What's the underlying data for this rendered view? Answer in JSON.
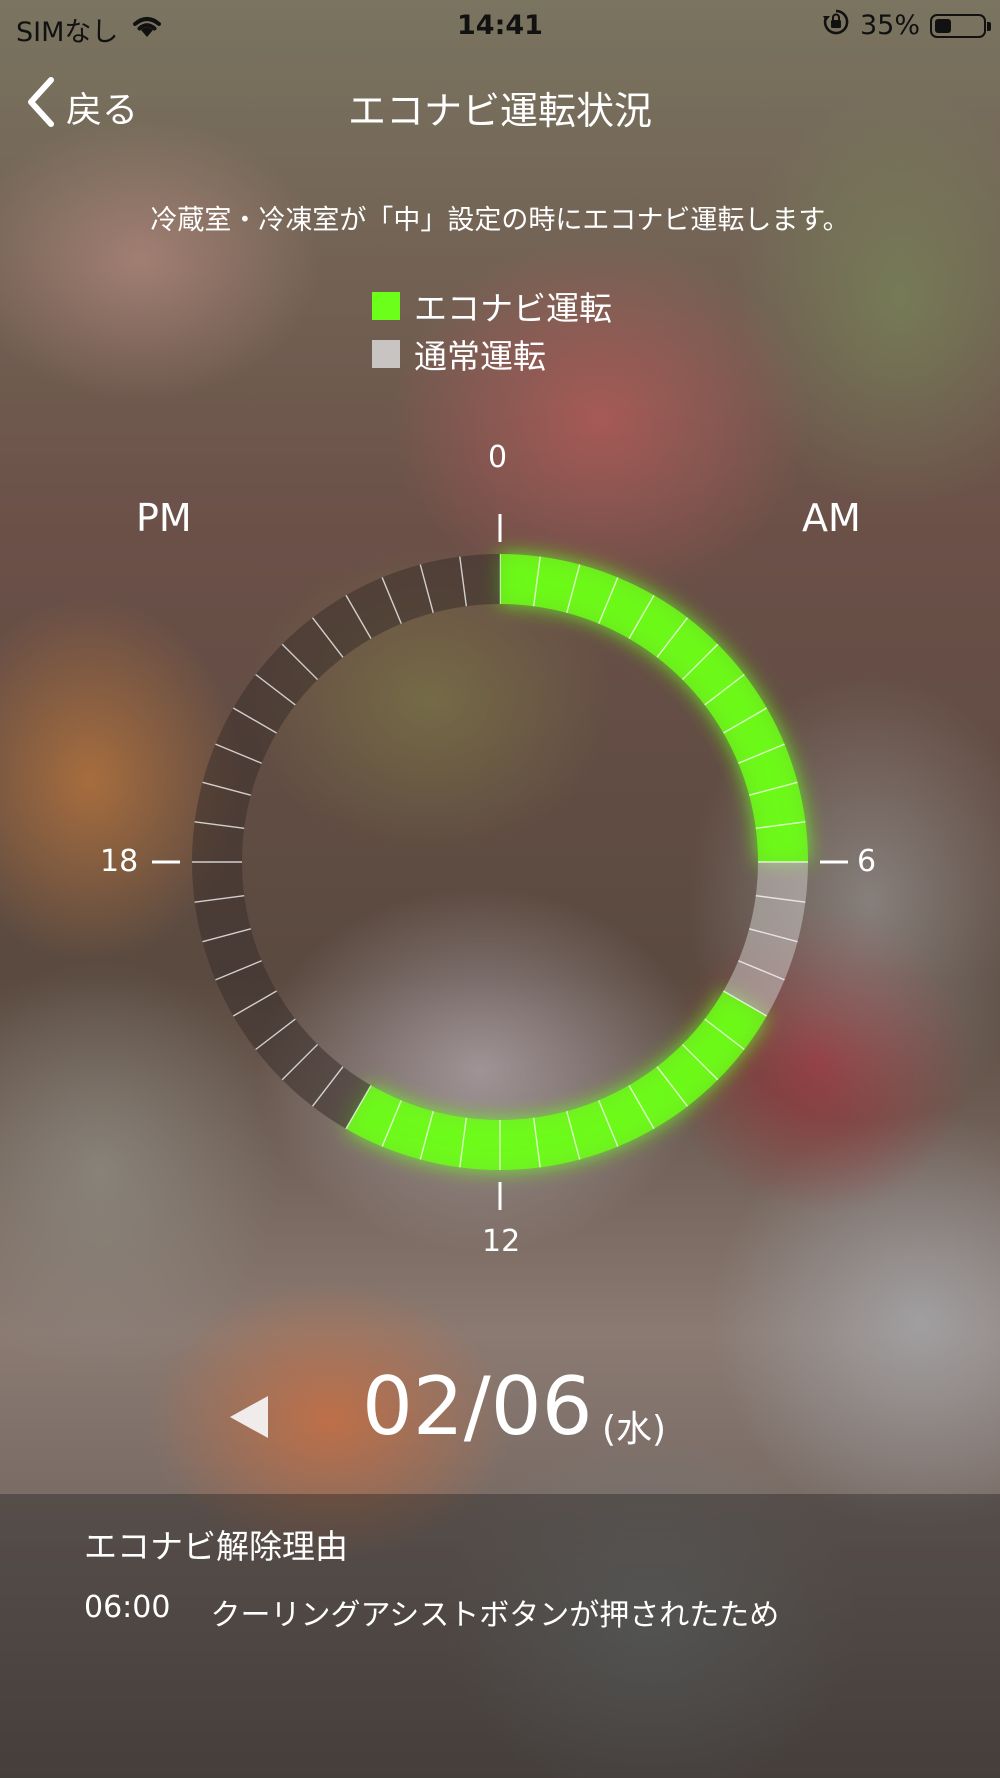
{
  "status_bar": {
    "carrier": "SIMなし",
    "time": "14:41",
    "battery_percent": "35%",
    "battery_level": 0.35,
    "icons": [
      "wifi-icon",
      "orientation-lock-icon",
      "battery-icon"
    ]
  },
  "nav": {
    "back_label": "戻る",
    "title": "エコナビ運転状況"
  },
  "description": "冷蔵室・冷凍室が「中」設定の時にエコナビ運転します。",
  "legend": [
    {
      "label": "エコナビ運転",
      "color": "#6cff1a"
    },
    {
      "label": "通常運転",
      "color": "#c8c4c2"
    }
  ],
  "clock": {
    "labels": {
      "top": "0",
      "right": "6",
      "bottom": "12",
      "left": "18",
      "am": "AM",
      "pm": "PM"
    }
  },
  "chart_data": {
    "type": "radial-timeline",
    "segments_per_day": 48,
    "categories": [
      "エコナビ運転",
      "通常運転"
    ],
    "intervals": [
      {
        "start": "00:00",
        "end": "06:00",
        "mode": "エコナビ運転"
      },
      {
        "start": "06:00",
        "end": "08:00",
        "mode": "通常運転"
      },
      {
        "start": "08:00",
        "end": "14:00",
        "mode": "エコナビ運転"
      },
      {
        "start": "14:00",
        "end": "24:00",
        "mode": "未記録"
      }
    ],
    "colors": {
      "エコナビ運転": "#6cff1a",
      "通常運転": "#c8c4c2",
      "未記録": "#3a302c"
    }
  },
  "date": {
    "prev_icon": "triangle-left-icon",
    "date": "02/06",
    "weekday": "(水)"
  },
  "reason": {
    "title": "エコナビ解除理由",
    "items": [
      {
        "time": "06:00",
        "text": "クーリングアシストボタンが押されたため"
      }
    ]
  }
}
